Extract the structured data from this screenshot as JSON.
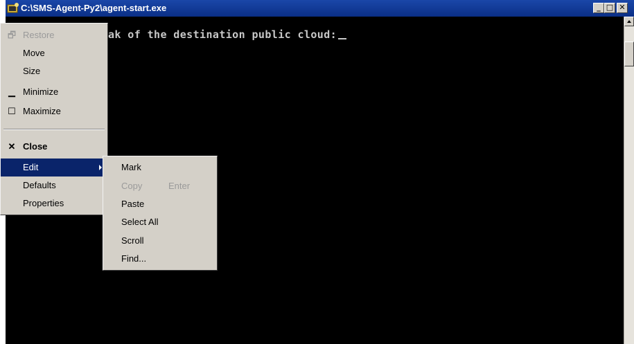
{
  "window": {
    "title": "C:\\SMS-Agent-Py2\\agent-start.exe",
    "controls": {
      "minimize": "_",
      "maximize": "□",
      "close": "✕"
    }
  },
  "console": {
    "line": "ak of the destination public cloud:"
  },
  "system_menu": {
    "items": [
      {
        "label": "Restore",
        "icon": "restore-icon",
        "glyph": "🗗",
        "disabled": true
      },
      {
        "label": "Move"
      },
      {
        "label": "Size"
      },
      {
        "label": "Minimize",
        "icon": "minimize-icon",
        "glyph": "▁"
      },
      {
        "label": "Maximize",
        "icon": "maximize-icon",
        "glyph": "☐"
      },
      {
        "label": "Close",
        "icon": "close-icon",
        "glyph": "✕",
        "bold": true
      },
      {
        "label": "Edit",
        "highlighted": true,
        "submenu": true
      },
      {
        "label": "Defaults"
      },
      {
        "label": "Properties"
      }
    ]
  },
  "edit_submenu": {
    "items": [
      {
        "label": "Mark"
      },
      {
        "label": "Copy",
        "shortcut": "Enter",
        "disabled": true
      },
      {
        "label": "Paste"
      },
      {
        "label": "Select All"
      },
      {
        "label": "Scroll"
      },
      {
        "label": "Find..."
      }
    ]
  },
  "colors": {
    "titlebar": "#0a2f86",
    "highlight": "#0a246a",
    "menu_bg": "#d4d0c8"
  }
}
